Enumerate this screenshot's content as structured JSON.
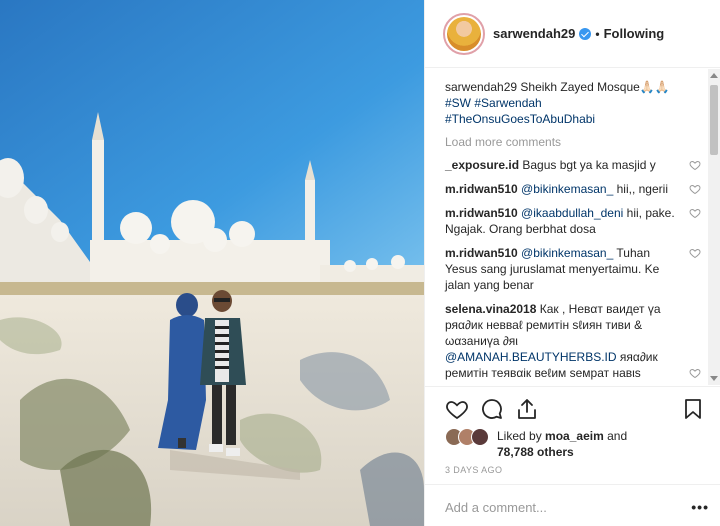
{
  "post": {
    "username": "sarwendah29",
    "separator": "•",
    "follow_status": "Following",
    "caption": {
      "username": "sarwendah29",
      "text": "Sheikh Zayed Mosque🙏🏻🙏🏻",
      "tags": [
        "#SW #Sarwendah",
        "#TheOnsuGoesToAbuDhabi"
      ]
    },
    "load_more": "Load more comments",
    "comments": [
      {
        "username": "_exposure.id",
        "text": "Bagus bgt ya ka masjid y"
      },
      {
        "username": "m.ridwan510",
        "mention": "@bikinkemasan_",
        "text": "hii,, ngerii"
      },
      {
        "username": "m.ridwan510",
        "mention": "@ikaabdullah_deni",
        "text": "hii, pake. Ngajak. Orang berbhat dosa"
      },
      {
        "username": "m.ridwan510",
        "mention": "@bikinkemasan_",
        "text": "Tuhan Yesus sang juruslamat menyertaimu. Ke jalan yang benar"
      },
      {
        "username": "selena.vina2018",
        "text": "Как , Невαт ваидет үа ряα∂ик невваℓ ремитін ѕℓиян тиви & ωαзаниүа ∂яι",
        "mention": "@AMANAH.BEAUTYHERBS.ID",
        "text2": "яяα∂ик ремитін теявαік веℓим ѕемpат навιѕ"
      }
    ],
    "likes": {
      "prefix": "Liked by",
      "user": "moa_aeim",
      "and": "and",
      "others": "78,788 others"
    },
    "time": "3 DAYS AGO",
    "add_comment_placeholder": "Add a comment...",
    "more_options": "•••"
  },
  "icons": {
    "heart": "heart-icon",
    "comment": "comment-icon",
    "share": "share-icon",
    "bookmark": "bookmark-icon",
    "verified": "verified-badge-icon"
  },
  "colors": {
    "link": "#003569",
    "verified": "#3897f0",
    "muted": "#999999",
    "sky": "#2f8ad0"
  }
}
